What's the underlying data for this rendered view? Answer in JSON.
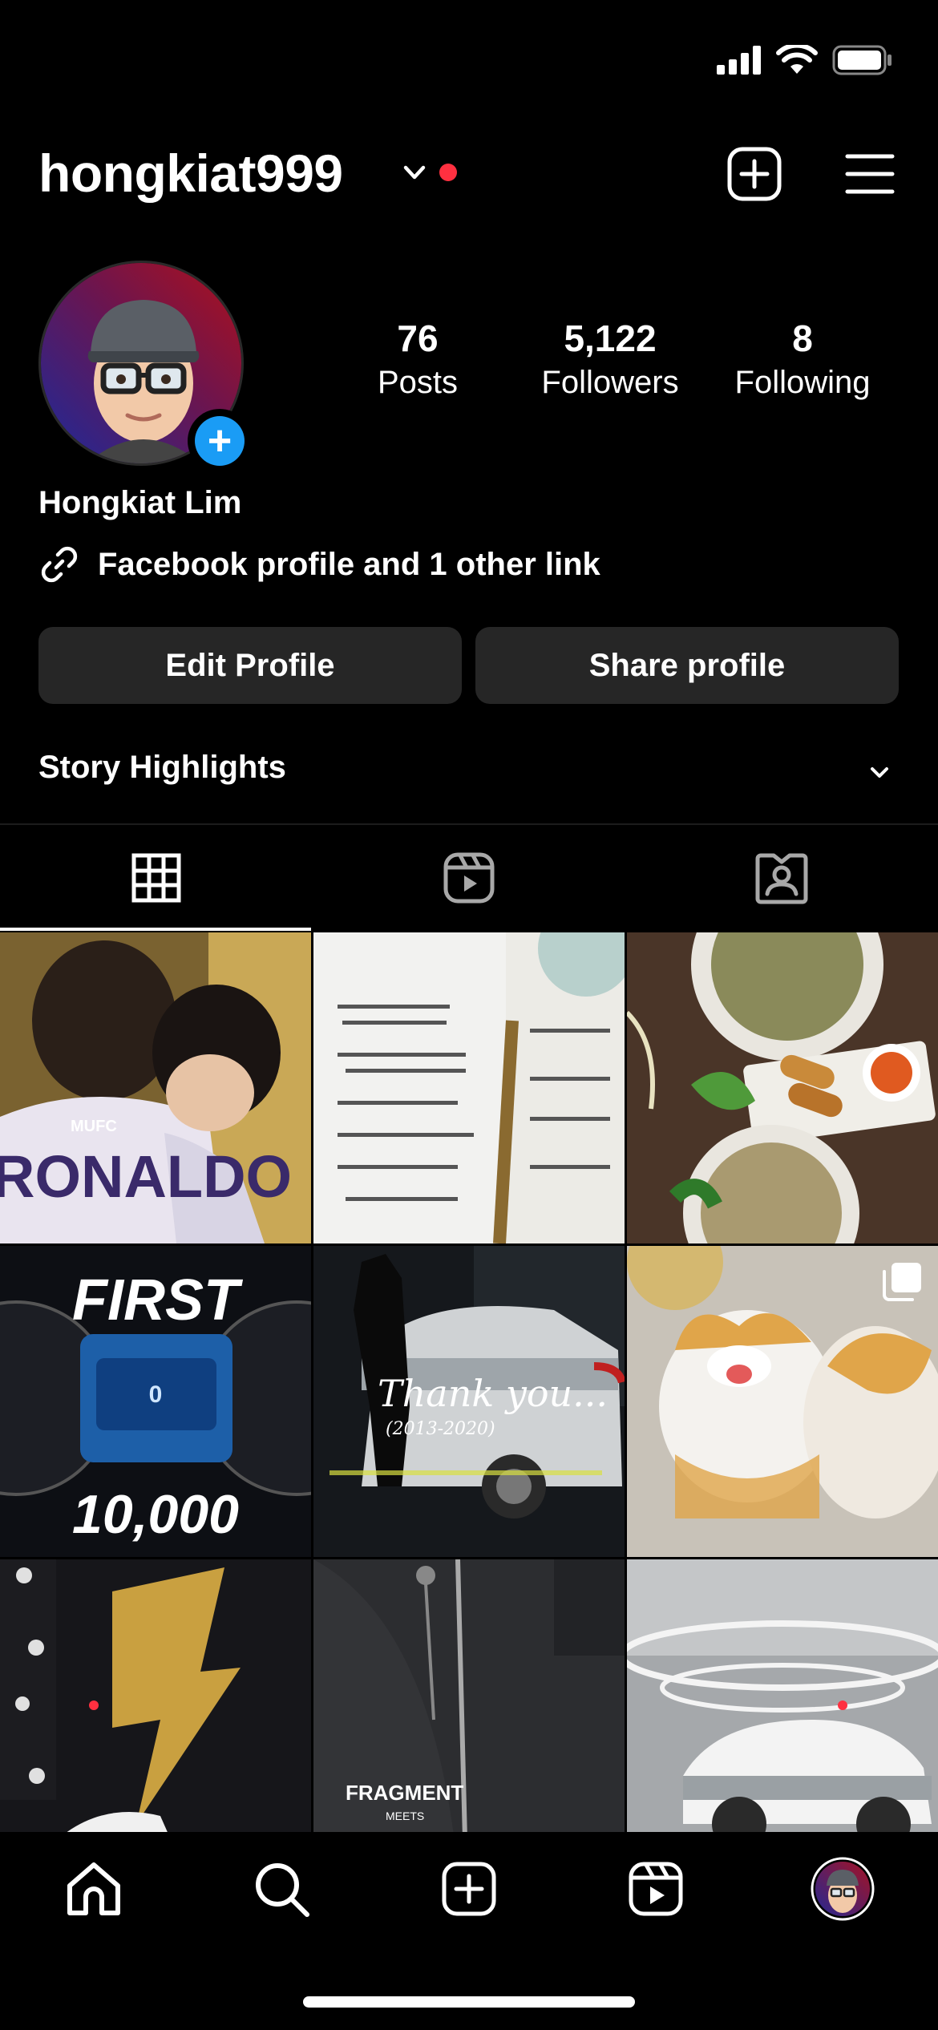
{
  "header": {
    "username": "hongkiat999"
  },
  "profile": {
    "display_name": "Hongkiat Lim",
    "link_text": "Facebook profile and 1 other link",
    "stats": [
      {
        "value": "76",
        "label": "Posts"
      },
      {
        "value": "5,122",
        "label": "Followers"
      },
      {
        "value": "8",
        "label": "Following"
      }
    ],
    "edit_button": "Edit Profile",
    "share_button": "Share profile",
    "highlights_label": "Story Highlights"
  },
  "tabs": [
    {
      "name": "grid",
      "icon": "grid-icon",
      "active": true
    },
    {
      "name": "reels",
      "icon": "reels-icon",
      "active": false
    },
    {
      "name": "tagged",
      "icon": "tagged-icon",
      "active": false
    }
  ],
  "posts": [
    {
      "icon": "photo",
      "text": "RONALDO",
      "sub": "MUFC"
    },
    {
      "icon": "photo"
    },
    {
      "icon": "photo"
    },
    {
      "icon": "photo",
      "text": "FIRST",
      "sub": "10,000"
    },
    {
      "icon": "photo",
      "text": "Thank you...",
      "sub": "(2013-2020)"
    },
    {
      "icon": "photo",
      "multiple": true
    },
    {
      "icon": "photo"
    },
    {
      "icon": "photo",
      "text": "FRAGMENT",
      "sub": "MEETS"
    },
    {
      "icon": "photo"
    }
  ],
  "nav": [
    "home-icon",
    "search-icon",
    "create-icon",
    "reels-icon",
    "profile-avatar"
  ],
  "colors": {
    "background": "#000000",
    "button": "#262626",
    "accent_blue": "#1a9cf5",
    "notification_red": "#ff3040"
  }
}
